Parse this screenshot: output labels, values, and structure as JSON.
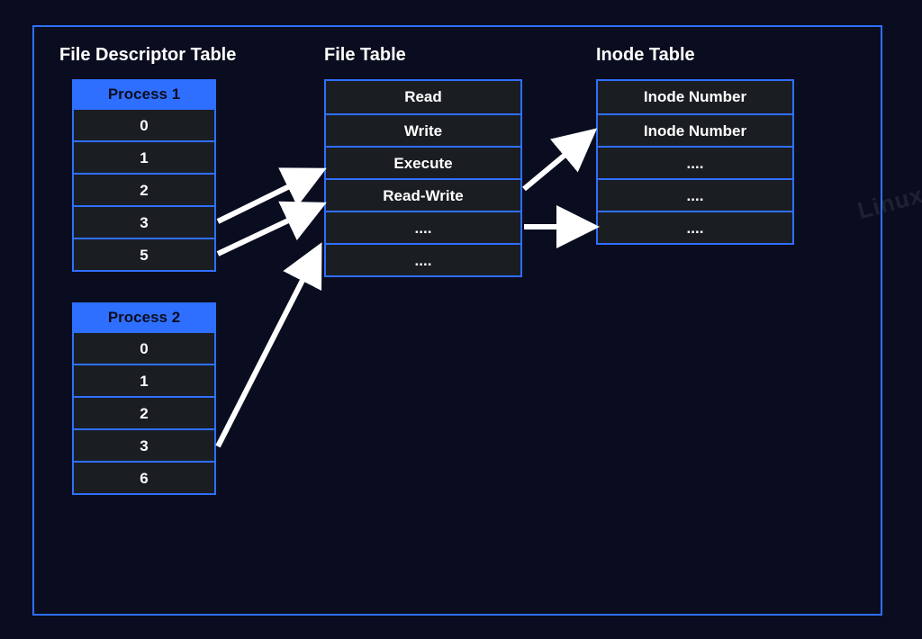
{
  "titles": {
    "fd": "File Descriptor Table",
    "file": "File Table",
    "inode": "Inode Table"
  },
  "fd_tables": [
    {
      "header": "Process 1",
      "rows": [
        "0",
        "1",
        "2",
        "3",
        "5"
      ]
    },
    {
      "header": "Process 2",
      "rows": [
        "0",
        "1",
        "2",
        "3",
        "6"
      ]
    }
  ],
  "file_table": {
    "rows": [
      "Read",
      "Write",
      "Execute",
      "Read-Write",
      "....",
      "...."
    ]
  },
  "inode_table": {
    "rows": [
      "Inode Number",
      "Inode Number",
      "....",
      "....",
      "...."
    ]
  },
  "watermark": "Linux"
}
